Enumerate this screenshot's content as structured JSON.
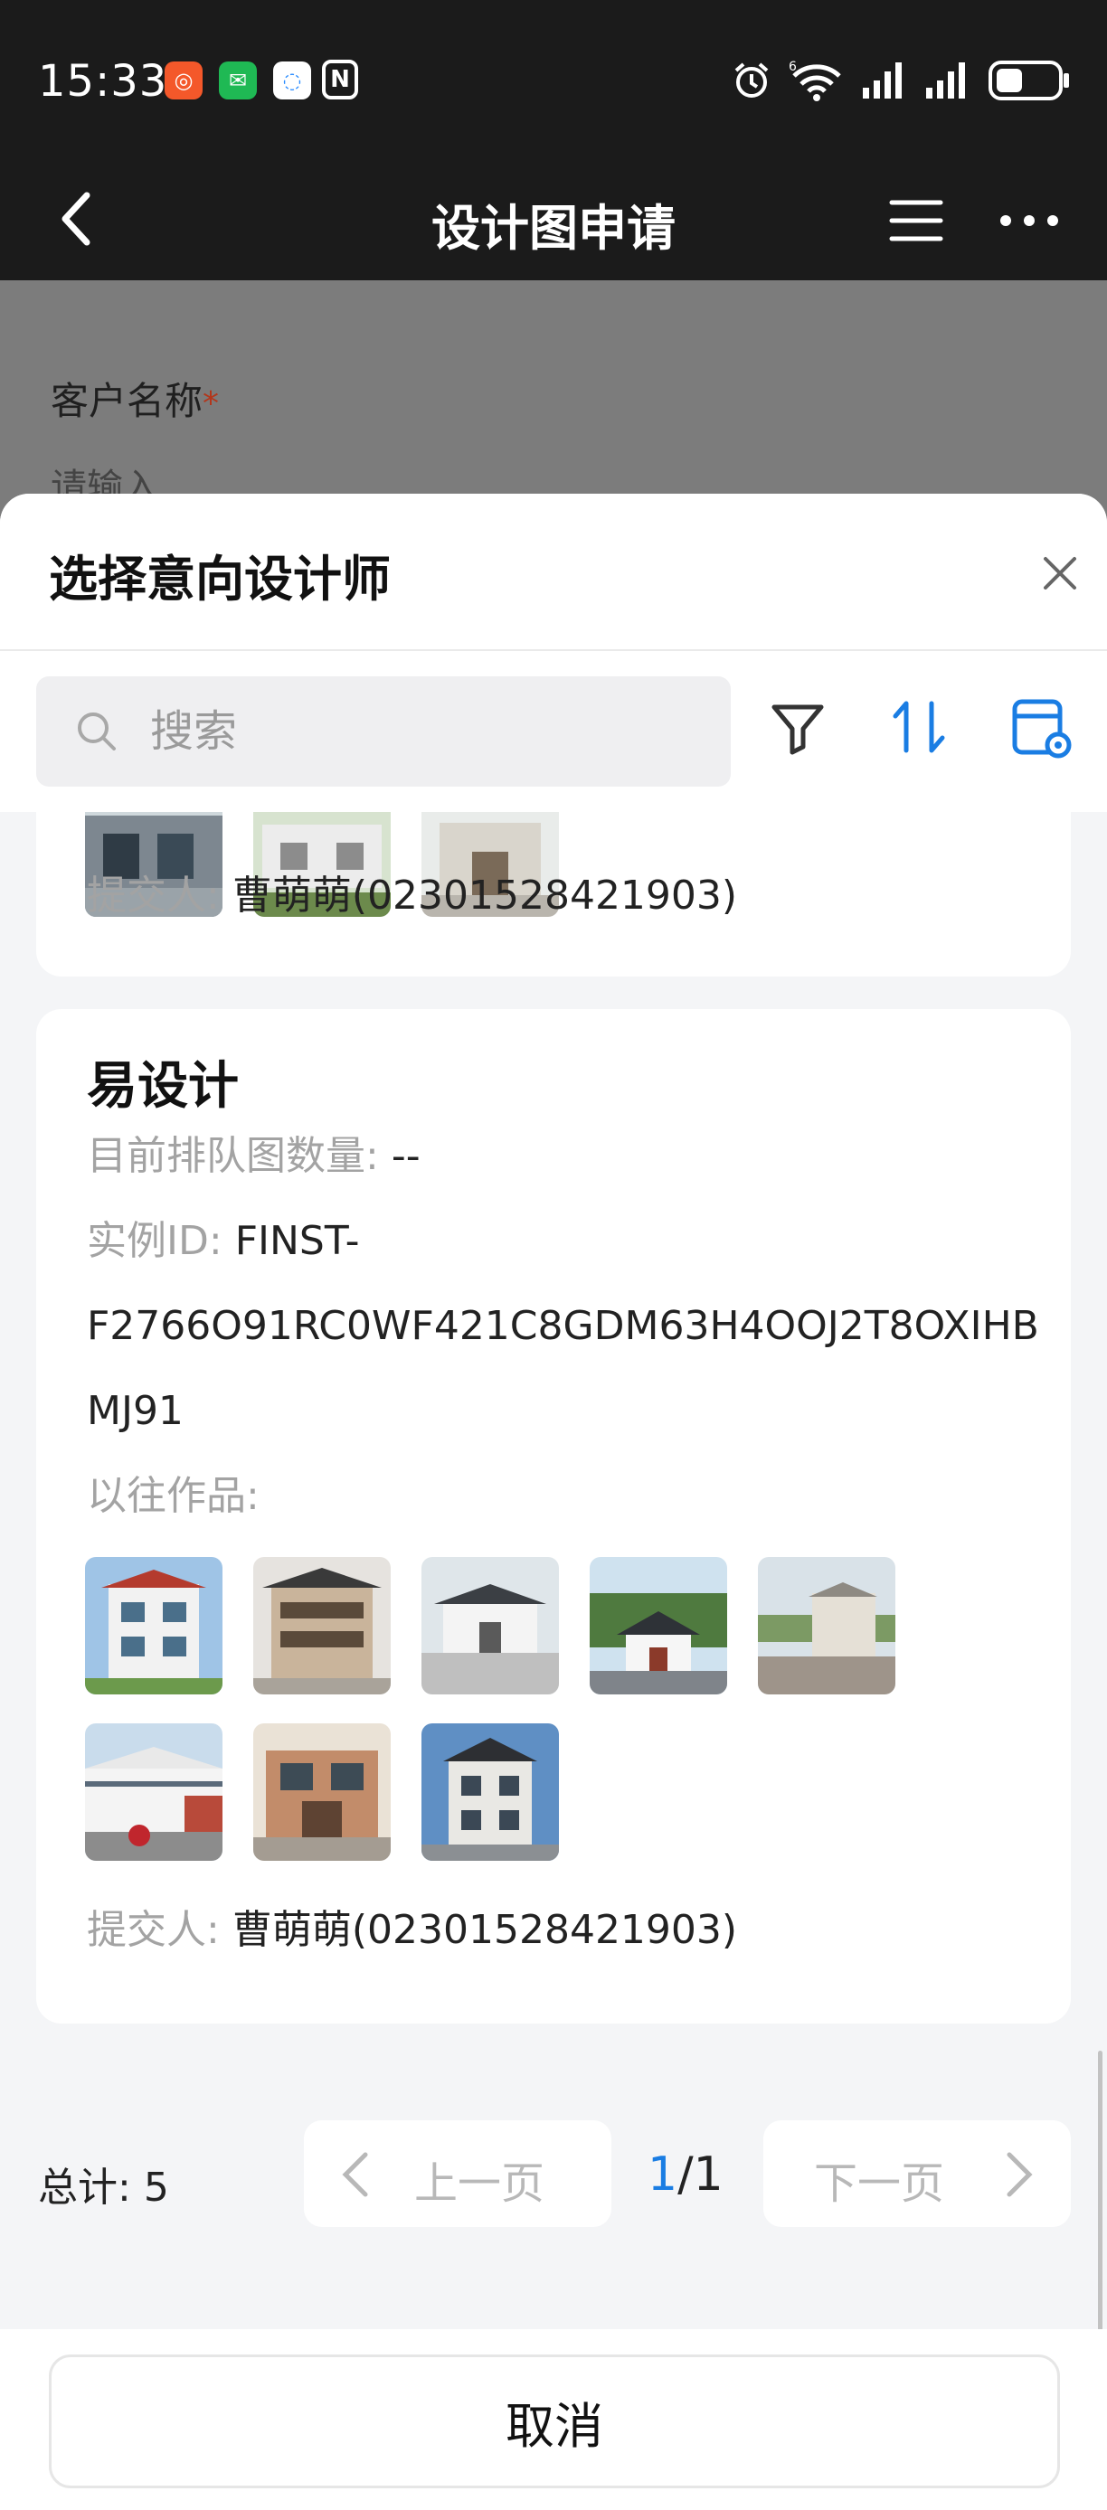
{
  "status_bar": {
    "time": "15:33",
    "app_icons": [
      "kuaishou-icon",
      "wechat-icon",
      "chat-bubble-icon",
      "nfc-icon"
    ],
    "right_icons": [
      "alarm-icon",
      "wifi-6-icon",
      "signal-icon",
      "signal-icon",
      "battery-icon"
    ]
  },
  "nav": {
    "title": "设计图申请"
  },
  "background_form": {
    "field_label": "客户名称",
    "required_mark": "*",
    "placeholder": "请输入"
  },
  "sheet": {
    "title": "选择意向设计师",
    "search_placeholder": "搜索",
    "toolbar_icons": [
      "filter-icon",
      "sort-icon",
      "view-settings-icon"
    ]
  },
  "cards": [
    {
      "submitter_label": "提交人:",
      "submitter_value": "曹萌萌(02301528421903)"
    },
    {
      "title": "易设计",
      "queue_label": "目前排队图数量:",
      "queue_value": "--",
      "instance_label": "实例ID:",
      "instance_value_line1": "FINST-",
      "instance_value_rest": "F2766O91RC0WF421C8GDM63H4OOJ2T8OXIHBMJ91",
      "works_label": "以往作品:",
      "works_count": 8,
      "submitter_label": "提交人:",
      "submitter_value": "曹萌萌(02301528421903)"
    }
  ],
  "pagination": {
    "total_label": "总计:",
    "total_value": "5",
    "prev_label": "上一页",
    "next_label": "下一页",
    "current_page": "1",
    "page_separator": "/1"
  },
  "footer": {
    "cancel_label": "取消"
  }
}
